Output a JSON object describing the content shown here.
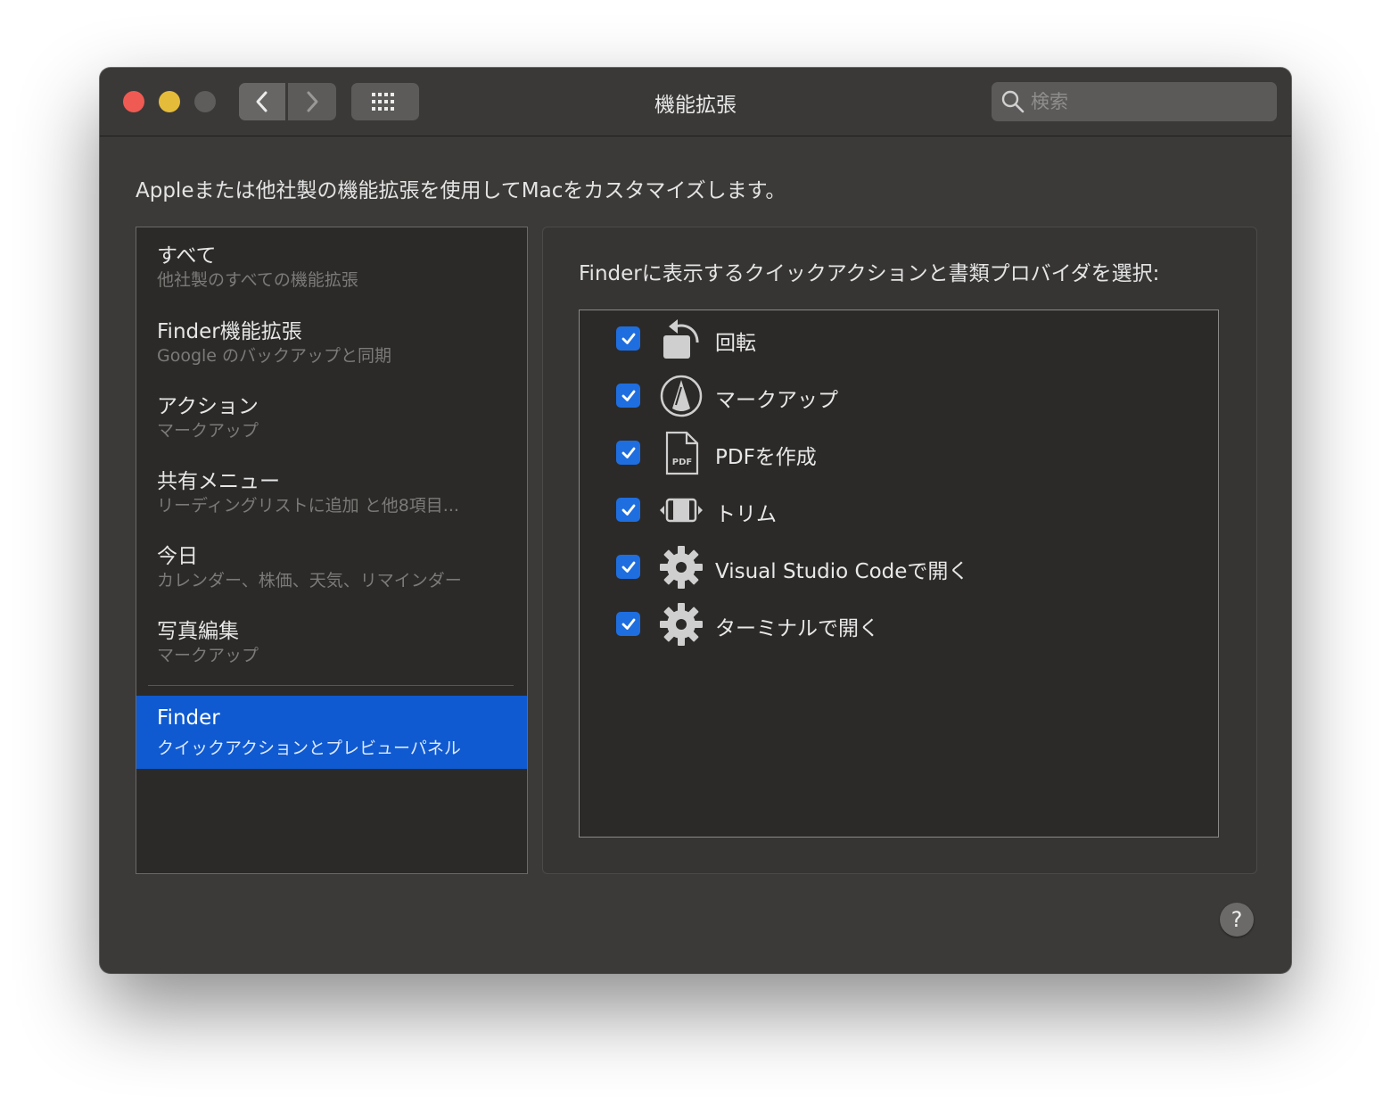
{
  "window": {
    "title": "機能拡張",
    "search_placeholder": "検索"
  },
  "description": "Appleまたは他社製の機能拡張を使用してMacをカスタマイズします。",
  "sidebar": {
    "items": [
      {
        "title": "すべて",
        "subtitle": "他社製のすべての機能拡張"
      },
      {
        "title": "Finder機能拡張",
        "subtitle": "Google のバックアップと同期"
      },
      {
        "title": "アクション",
        "subtitle": "マークアップ"
      },
      {
        "title": "共有メニュー",
        "subtitle": "リーディングリストに追加 と他8項目..."
      },
      {
        "title": "今日",
        "subtitle": "カレンダー、株価、天気、リマインダー"
      },
      {
        "title": "写真編集",
        "subtitle": "マークアップ"
      }
    ],
    "selected": {
      "title": "Finder",
      "subtitle": "クイックアクションとプレビューパネル"
    }
  },
  "detail": {
    "heading": "Finderに表示するクイックアクションと書類プロバイダを選択:",
    "actions": [
      {
        "label": "回転",
        "icon": "rotate-icon",
        "checked": true
      },
      {
        "label": "マークアップ",
        "icon": "markup-icon",
        "checked": true
      },
      {
        "label": "PDFを作成",
        "icon": "pdf-document-icon",
        "checked": true,
        "icon_text": "PDF"
      },
      {
        "label": "トリム",
        "icon": "trim-icon",
        "checked": true
      },
      {
        "label": "Visual Studio Codeで開く",
        "icon": "gear-icon",
        "checked": true
      },
      {
        "label": "ターミナルで開く",
        "icon": "gear-icon",
        "checked": true
      }
    ]
  },
  "help_label": "?",
  "colors": {
    "selection": "#0f5ad0",
    "checkbox": "#1f6ee0",
    "close": "#ef5a53",
    "minimize": "#e5bc3a"
  }
}
